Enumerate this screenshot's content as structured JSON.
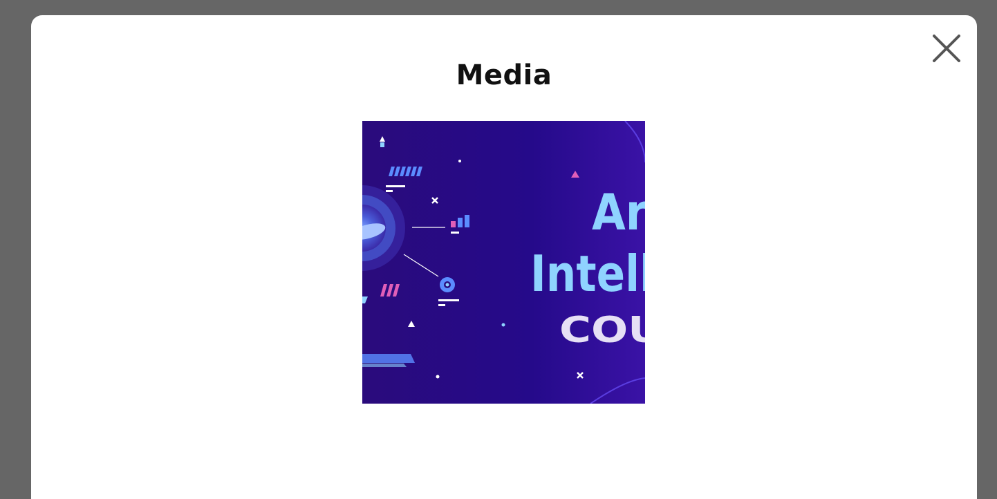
{
  "modal": {
    "title": "Media",
    "close_icon": "close-icon"
  },
  "media": {
    "line1": "Art",
    "line2": "Intelli",
    "line3": "COU",
    "colors": {
      "background": "#2a0a86",
      "headline": "#8fd3ff",
      "sub": "#e6e0f5",
      "pink": "#e05fb8",
      "blue": "#5b8cff"
    }
  }
}
